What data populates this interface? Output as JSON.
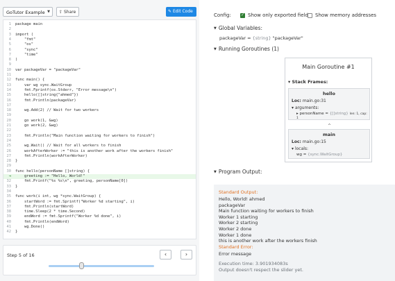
{
  "toolbar": {
    "example_select": "GoTutor Example",
    "share_label": "Share",
    "edit_label": "Edit Code"
  },
  "code": {
    "lines": [
      {
        "n": "1",
        "text": "package main"
      },
      {
        "n": "2",
        "text": ""
      },
      {
        "n": "3",
        "text": "import ("
      },
      {
        "n": "4",
        "text": "    \"fmt\""
      },
      {
        "n": "5",
        "text": "    \"os\""
      },
      {
        "n": "6",
        "text": "    \"sync\""
      },
      {
        "n": "7",
        "text": "    \"time\""
      },
      {
        "n": "8",
        "text": ")"
      },
      {
        "n": "9",
        "text": ""
      },
      {
        "n": "10",
        "text": "var packageVar = \"packageVar\""
      },
      {
        "n": "11",
        "text": ""
      },
      {
        "n": "12",
        "text": "func main() {"
      },
      {
        "n": "13",
        "text": "    var wg sync.WaitGroup"
      },
      {
        "n": "14",
        "text": "    fmt.Fprintf(os.Stderr, \"Error message\\n\")"
      },
      {
        "n": "15",
        "text": "    hello([]string{\"ahmed\"})"
      },
      {
        "n": "16",
        "text": "    fmt.Println(packageVar)"
      },
      {
        "n": "17",
        "text": ""
      },
      {
        "n": "18",
        "text": "    wg.Add(2) // Wait for two workers"
      },
      {
        "n": "19",
        "text": ""
      },
      {
        "n": "20",
        "text": "    go work(1, &wg)"
      },
      {
        "n": "21",
        "text": "    go work(2, &wg)"
      },
      {
        "n": "22",
        "text": ""
      },
      {
        "n": "23",
        "text": "    fmt.Println(\"Main function waiting for workers to finish\")"
      },
      {
        "n": "24",
        "text": ""
      },
      {
        "n": "25",
        "text": "    wg.Wait() // Wait for all workers to finish"
      },
      {
        "n": "26",
        "text": "    workAfterWorker := \"this is another work after the workers finish\""
      },
      {
        "n": "27",
        "text": "    fmt.Println(workAfterWorker)"
      },
      {
        "n": "28",
        "text": "}"
      },
      {
        "n": "29",
        "text": ""
      },
      {
        "n": "30",
        "text": "func hello(personName []string) {"
      },
      {
        "n": "→",
        "text": "    greeting := \"Hello, World!\""
      },
      {
        "n": "32",
        "text": "    fmt.Printf(\"%s %s\\n\", greeting, personName[0])"
      },
      {
        "n": "33",
        "text": "}"
      },
      {
        "n": "34",
        "text": ""
      },
      {
        "n": "35",
        "text": "func work(i int, wg *sync.WaitGroup) {"
      },
      {
        "n": "36",
        "text": "    startWord := fmt.Sprintf(\"Worker %d starting\", i)"
      },
      {
        "n": "37",
        "text": "    fmt.Println(startWord)"
      },
      {
        "n": "38",
        "text": "    time.Sleep(2 * time.Second)"
      },
      {
        "n": "39",
        "text": "    endWord := fmt.Sprintf(\"Worker %d done\", i)"
      },
      {
        "n": "40",
        "text": "    fmt.Println(endWord)"
      },
      {
        "n": "41",
        "text": "    wg.Done()"
      },
      {
        "n": "42",
        "text": "}"
      }
    ]
  },
  "stepper": {
    "label": "Step 5 of 16",
    "prev": "‹",
    "next": "›",
    "progress": 0.31
  },
  "config": {
    "label": "Config:",
    "exported_label": "Show only exported fields",
    "exported_checked": true,
    "memory_label": "Show memory addresses",
    "memory_checked": false
  },
  "globals": {
    "title": "Global Variables:",
    "name": "packageVar",
    "eq": "=",
    "type": "{string}",
    "value": "\"packageVar\""
  },
  "goroutines": {
    "title": "Running Goroutines (1)",
    "main_title": "Main Goroutine #1",
    "stack_title": "Stack Frames:",
    "frames": [
      {
        "name": "hello",
        "loc_key": "Loc:",
        "loc": "main.go:31",
        "sub_title": "arguments:",
        "var_name": "personName",
        "eq": "=",
        "var_type": "{[]string}",
        "var_extra": "len: 1, cap: 1"
      },
      {
        "name": "main",
        "loc_key": "Loc:",
        "loc": "main.go:15",
        "sub_title": "locals:",
        "var_name": "wg",
        "eq": "=",
        "var_type": "{sync.WaitGroup}"
      }
    ],
    "chevron": "^"
  },
  "output": {
    "title": "Program Output:",
    "stdout_label": "Standard Output:",
    "stdout": [
      "Hello, World! ahmed",
      "packageVar",
      "Main function waiting for workers to finish",
      "Worker 1 starting",
      "Worker 2 starting",
      "Worker 2 done",
      "Worker 1 done",
      "this is another work after the workers finish"
    ],
    "stderr_label": "Standard Error:",
    "stderr": "Error message",
    "exec_time": "Execution time: 3.901934083s",
    "note": "Output doesn't respect the slider yet."
  }
}
